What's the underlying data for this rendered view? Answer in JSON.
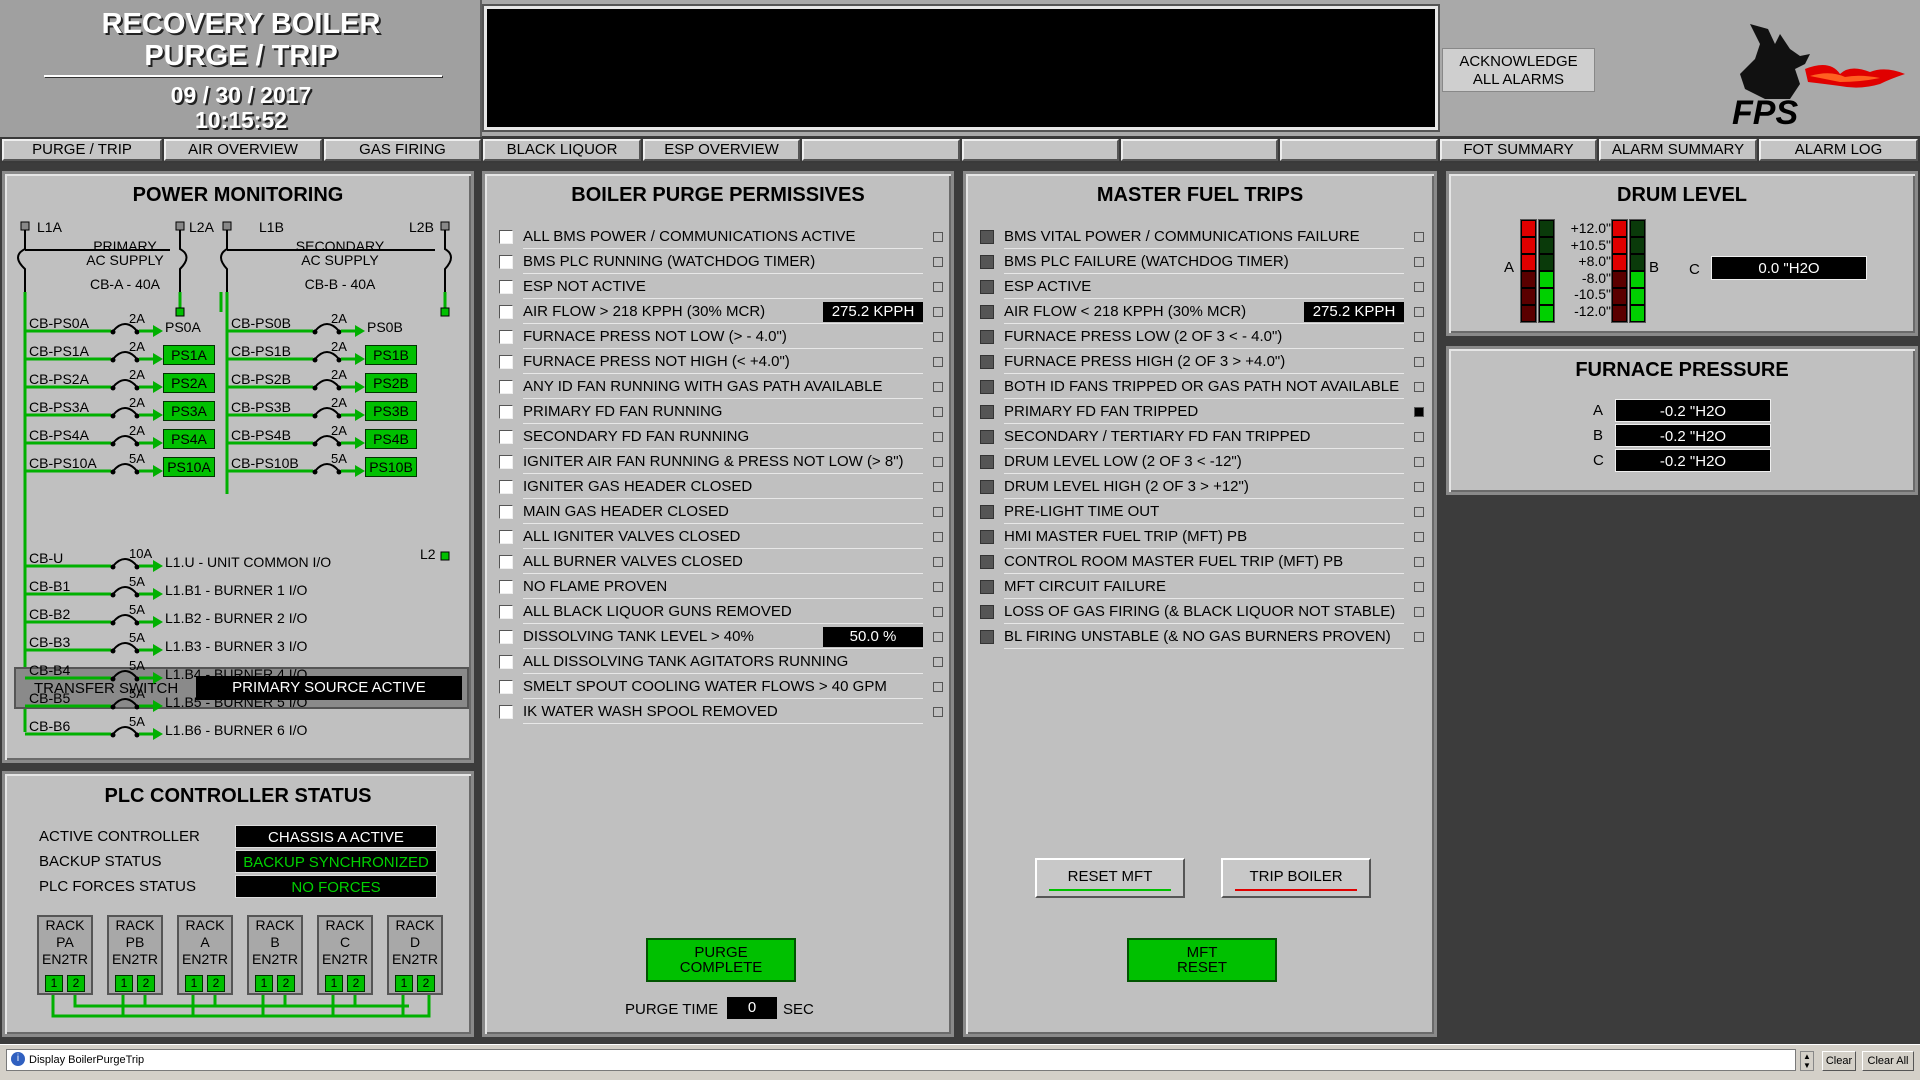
{
  "header": {
    "title_line1": "RECOVERY BOILER",
    "title_line2": "PURGE / TRIP",
    "date": "09  /  30  /  2017",
    "time": "10:15:52",
    "ack_line1": "ACKNOWLEDGE",
    "ack_line2": "ALL ALARMS",
    "logo_text": "FPS"
  },
  "nav": {
    "items": [
      "PURGE / TRIP",
      "AIR OVERVIEW",
      "GAS FIRING",
      "BLACK LIQUOR",
      "ESP OVERVIEW",
      "",
      "",
      "",
      "",
      "FOT SUMMARY",
      "ALARM SUMMARY",
      "ALARM LOG"
    ]
  },
  "power": {
    "title": "POWER MONITORING",
    "l1a": "L1A",
    "l2a": "L2A",
    "l1b": "L1B",
    "l2b": "L2B",
    "l2": "L2",
    "primary_1": "PRIMARY",
    "primary_2": "AC SUPPLY",
    "primary_cb": "CB-A - 40A",
    "secondary_1": "SECONDARY",
    "secondary_2": "AC SUPPLY",
    "secondary_cb": "CB-B - 40A",
    "left": [
      {
        "cb": "CB-PS0A",
        "amp": "2A",
        "out": "PS0A"
      },
      {
        "cb": "CB-PS1A",
        "amp": "2A",
        "out": "PS1A"
      },
      {
        "cb": "CB-PS2A",
        "amp": "2A",
        "out": "PS2A"
      },
      {
        "cb": "CB-PS3A",
        "amp": "2A",
        "out": "PS3A"
      },
      {
        "cb": "CB-PS4A",
        "amp": "2A",
        "out": "PS4A"
      },
      {
        "cb": "CB-PS10A",
        "amp": "5A",
        "out": "PS10A"
      }
    ],
    "right": [
      {
        "cb": "CB-PS0B",
        "amp": "2A",
        "out": "PS0B"
      },
      {
        "cb": "CB-PS1B",
        "amp": "2A",
        "out": "PS1B"
      },
      {
        "cb": "CB-PS2B",
        "amp": "2A",
        "out": "PS2B"
      },
      {
        "cb": "CB-PS3B",
        "amp": "2A",
        "out": "PS3B"
      },
      {
        "cb": "CB-PS4B",
        "amp": "2A",
        "out": "PS4B"
      },
      {
        "cb": "CB-PS10B",
        "amp": "5A",
        "out": "PS10B"
      }
    ],
    "transfer_label": "TRANSFER SWITCH",
    "transfer_value": "PRIMARY SOURCE ACTIVE",
    "lower": [
      {
        "cb": "CB-U",
        "amp": "10A",
        "out": "L1.U - UNIT COMMON I/O"
      },
      {
        "cb": "CB-B1",
        "amp": "5A",
        "out": "L1.B1 - BURNER 1 I/O"
      },
      {
        "cb": "CB-B2",
        "amp": "5A",
        "out": "L1.B2 - BURNER 2 I/O"
      },
      {
        "cb": "CB-B3",
        "amp": "5A",
        "out": "L1.B3 - BURNER 3 I/O"
      },
      {
        "cb": "CB-B4",
        "amp": "5A",
        "out": "L1.B4 - BURNER 4 I/O"
      },
      {
        "cb": "CB-B5",
        "amp": "5A",
        "out": "L1.B5 - BURNER 5 I/O"
      },
      {
        "cb": "CB-B6",
        "amp": "5A",
        "out": "L1.B6 - BURNER 6 I/O"
      }
    ]
  },
  "plc": {
    "title": "PLC CONTROLLER STATUS",
    "rows": [
      {
        "label": "ACTIVE CONTROLLER",
        "value": "CHASSIS A ACTIVE",
        "color": "#ffffff"
      },
      {
        "label": "BACKUP STATUS",
        "value": "BACKUP SYNCHRONIZED",
        "color": "#00d000"
      },
      {
        "label": "PLC FORCES STATUS",
        "value": "NO FORCES",
        "color": "#00d000"
      }
    ],
    "racks": [
      {
        "l1": "RACK",
        "l2": "PA",
        "l3": "EN2TR"
      },
      {
        "l1": "RACK",
        "l2": "PB",
        "l3": "EN2TR"
      },
      {
        "l1": "RACK",
        "l2": "A",
        "l3": "EN2TR"
      },
      {
        "l1": "RACK",
        "l2": "B",
        "l3": "EN2TR"
      },
      {
        "l1": "RACK",
        "l2": "C",
        "l3": "EN2TR"
      },
      {
        "l1": "RACK",
        "l2": "D",
        "l3": "EN2TR"
      }
    ],
    "slot1": "1",
    "slot2": "2"
  },
  "purge": {
    "title": "BOILER PURGE PERMISSIVES",
    "items": [
      {
        "label": "ALL BMS POWER / COMMUNICATIONS ACTIVE",
        "value": ""
      },
      {
        "label": "BMS PLC RUNNING (WATCHDOG TIMER)",
        "value": ""
      },
      {
        "label": "ESP NOT ACTIVE",
        "value": ""
      },
      {
        "label": "AIR FLOW > 218 KPPH (30% MCR)",
        "value": "275.2 KPPH"
      },
      {
        "label": "FURNACE PRESS NOT LOW (> - 4.0\")",
        "value": ""
      },
      {
        "label": "FURNACE PRESS NOT HIGH (< +4.0\")",
        "value": ""
      },
      {
        "label": "ANY ID FAN RUNNING WITH GAS PATH AVAILABLE",
        "value": ""
      },
      {
        "label": "PRIMARY FD FAN RUNNING",
        "value": ""
      },
      {
        "label": "SECONDARY FD FAN RUNNING",
        "value": ""
      },
      {
        "label": "IGNITER AIR FAN RUNNING & PRESS NOT LOW (> 8\")",
        "value": ""
      },
      {
        "label": "IGNITER GAS HEADER CLOSED",
        "value": ""
      },
      {
        "label": "MAIN GAS HEADER CLOSED",
        "value": ""
      },
      {
        "label": "ALL IGNITER VALVES CLOSED",
        "value": ""
      },
      {
        "label": "ALL BURNER VALVES CLOSED",
        "value": ""
      },
      {
        "label": "NO FLAME PROVEN",
        "value": ""
      },
      {
        "label": "ALL BLACK LIQUOR GUNS REMOVED",
        "value": ""
      },
      {
        "label": "DISSOLVING TANK LEVEL > 40%",
        "value": "50.0 %"
      },
      {
        "label": "ALL DISSOLVING TANK AGITATORS RUNNING",
        "value": ""
      },
      {
        "label": "SMELT SPOUT COOLING WATER FLOWS > 40 GPM",
        "value": ""
      },
      {
        "label": "IK WATER WASH SPOOL REMOVED",
        "value": ""
      }
    ],
    "complete_line1": "PURGE",
    "complete_line2": "COMPLETE",
    "purge_time_label": "PURGE TIME",
    "purge_time_value": "0",
    "purge_time_unit": "SEC"
  },
  "mft": {
    "title": "MASTER FUEL TRIPS",
    "items": [
      {
        "label": "BMS VITAL POWER / COMMUNICATIONS FAILURE",
        "value": "",
        "active": false
      },
      {
        "label": "BMS PLC FAILURE (WATCHDOG TIMER)",
        "value": "",
        "active": false
      },
      {
        "label": "ESP ACTIVE",
        "value": "",
        "active": false
      },
      {
        "label": "AIR FLOW < 218 KPPH (30% MCR)",
        "value": "275.2 KPPH",
        "active": false
      },
      {
        "label": "FURNACE PRESS LOW (2 OF 3 < - 4.0\")",
        "value": "",
        "active": false
      },
      {
        "label": "FURNACE PRESS HIGH (2 OF 3 > +4.0\")",
        "value": "",
        "active": false
      },
      {
        "label": "BOTH ID FANS TRIPPED OR GAS PATH NOT AVAILABLE",
        "value": "",
        "active": false
      },
      {
        "label": "PRIMARY FD FAN TRIPPED",
        "value": "",
        "active": true
      },
      {
        "label": "SECONDARY / TERTIARY FD FAN TRIPPED",
        "value": "",
        "active": false
      },
      {
        "label": "DRUM LEVEL LOW (2 OF 3 < -12\")",
        "value": "",
        "active": false
      },
      {
        "label": "DRUM LEVEL HIGH (2 OF 3 > +12\")",
        "value": "",
        "active": false
      },
      {
        "label": "PRE-LIGHT TIME OUT",
        "value": "",
        "active": false
      },
      {
        "label": "HMI MASTER FUEL TRIP (MFT) PB",
        "value": "",
        "active": false
      },
      {
        "label": "CONTROL ROOM MASTER FUEL TRIP (MFT) PB",
        "value": "",
        "active": false
      },
      {
        "label": "MFT CIRCUIT FAILURE",
        "value": "",
        "active": false
      },
      {
        "label": "LOSS OF GAS FIRING (& BLACK LIQUOR NOT STABLE)",
        "value": "",
        "active": false
      },
      {
        "label": "BL FIRING UNSTABLE (& NO GAS BURNERS PROVEN)",
        "value": "",
        "active": false
      }
    ],
    "reset_btn": "RESET MFT",
    "trip_btn": "TRIP BOILER",
    "mft_reset_line1": "MFT",
    "mft_reset_line2": "RESET"
  },
  "drum": {
    "title": "DRUM LEVEL",
    "scale": [
      "+12.0\"",
      "+10.5\"",
      "+8.0\"",
      "-8.0\"",
      "-10.5\"",
      "-12.0\""
    ],
    "a_label": "A",
    "b_label": "B",
    "c_label": "C",
    "c_value": "0.0 \"H2O"
  },
  "furnace": {
    "title": "FURNACE PRESSURE",
    "rows": [
      {
        "label": "A",
        "value": "-0.2 \"H2O"
      },
      {
        "label": "B",
        "value": "-0.2 \"H2O"
      },
      {
        "label": "C",
        "value": "-0.2 \"H2O"
      }
    ]
  },
  "status": {
    "message": "Display BoilerPurgeTrip",
    "clear": "Clear",
    "clear_all": "Clear All"
  }
}
